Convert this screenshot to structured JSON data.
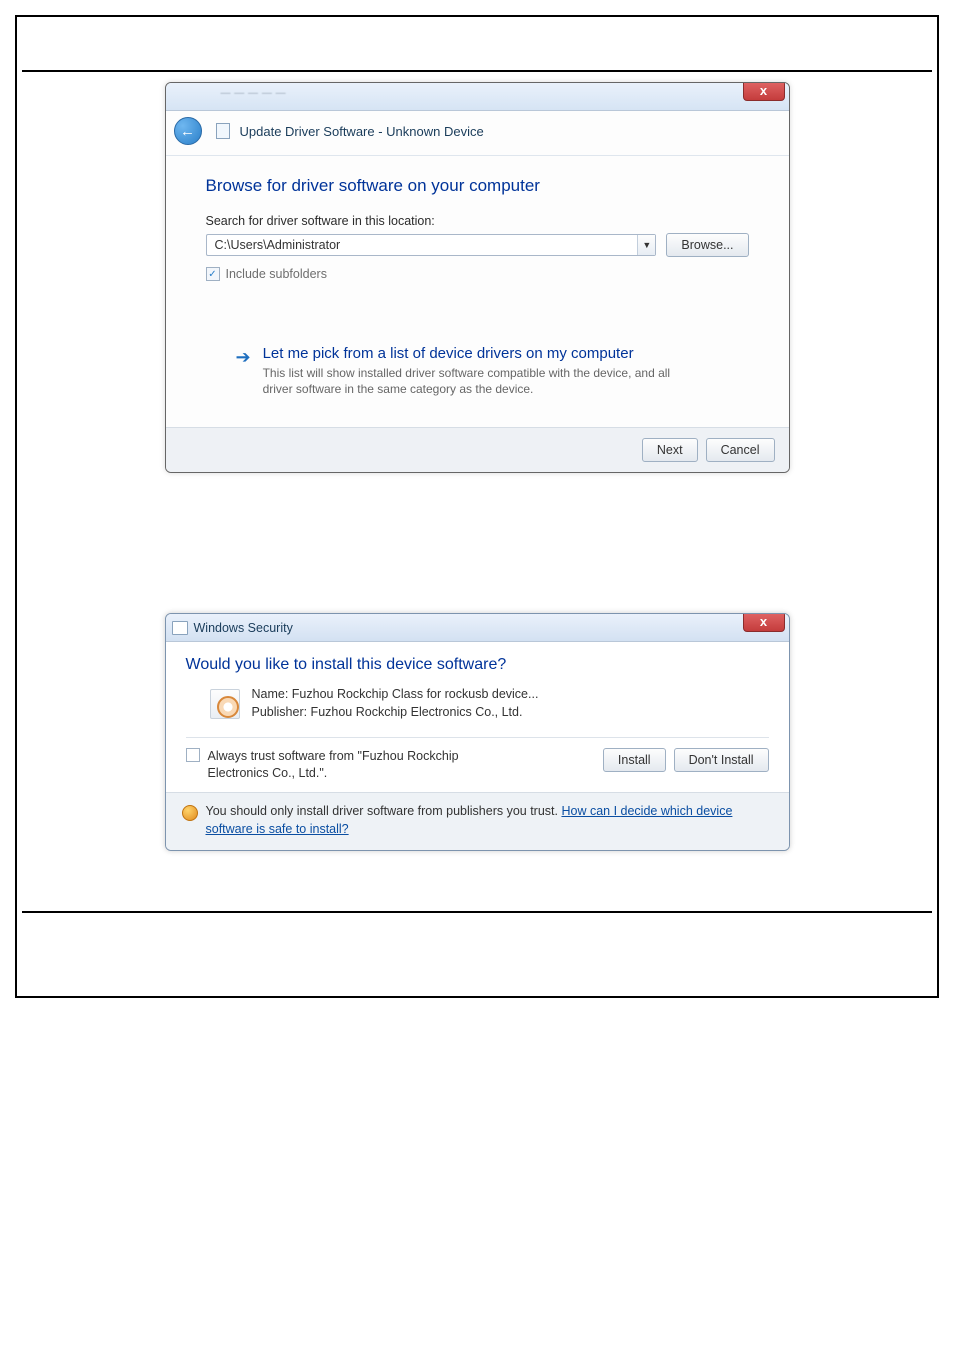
{
  "dialog1": {
    "close_glyph": "x",
    "header_title": "Update Driver Software - Unknown Device",
    "main_instruction": "Browse for driver software on your computer",
    "search_label": "Search for driver software in this location:",
    "path_value": "C:\\Users\\Administrator",
    "browse_btn": "Browse...",
    "include_subfolders": "Include subfolders",
    "cmd_title": "Let me pick from a list of device drivers on my computer",
    "cmd_desc": "This list will show installed driver software compatible with the device, and all driver software in the same category as the device.",
    "next_btn": "Next",
    "cancel_btn": "Cancel"
  },
  "dialog2": {
    "title": "Windows Security",
    "close_glyph": "x",
    "main_instruction": "Would you like to install this device software?",
    "name_line": "Name: Fuzhou Rockchip Class for rockusb device...",
    "publisher_line": "Publisher: Fuzhou Rockchip Electronics Co., Ltd.",
    "trust_label": "Always trust software from \"Fuzhou Rockchip Electronics Co., Ltd.\".",
    "install_btn": "Install",
    "dont_install_btn": "Don't Install",
    "footer_lead": "You should only install driver software from publishers you trust.  ",
    "footer_link": "How can I decide which device software is safe to install?"
  }
}
